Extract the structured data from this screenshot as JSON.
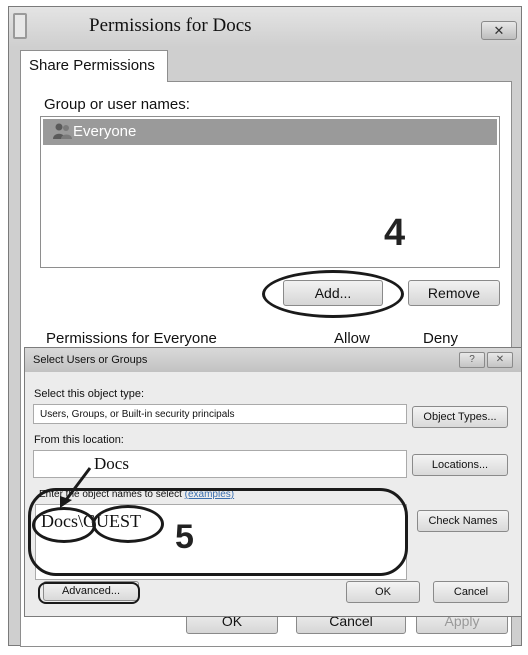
{
  "permissions_window": {
    "title": "Permissions for Docs",
    "close_icon": "close-x-icon",
    "tab_label": "Share Permissions",
    "group_label": "Group or user names:",
    "users": [
      "Everyone"
    ],
    "add_label": "Add...",
    "remove_label": "Remove",
    "permissions_for_label": "Permissions for Everyone",
    "allow_header": "Allow",
    "deny_header": "Deny",
    "ok_label": "OK",
    "cancel_label": "Cancel",
    "apply_label": "Apply"
  },
  "select_dialog": {
    "title": "Select Users or Groups",
    "object_type_label": "Select this object type:",
    "object_type_value": "Users, Groups, or Built-in security principals",
    "object_types_button": "Object Types...",
    "location_label": "From this location:",
    "location_value": "Docs",
    "locations_button": "Locations...",
    "enter_names_label": "Enter the object names to select",
    "examples_link": "(examples)",
    "names_value": "Docs\\GUEST",
    "check_names_button": "Check Names",
    "advanced_button": "Advanced...",
    "ok_button": "OK",
    "cancel_button": "Cancel"
  },
  "annotations": {
    "step4": "4",
    "step5": "5"
  }
}
